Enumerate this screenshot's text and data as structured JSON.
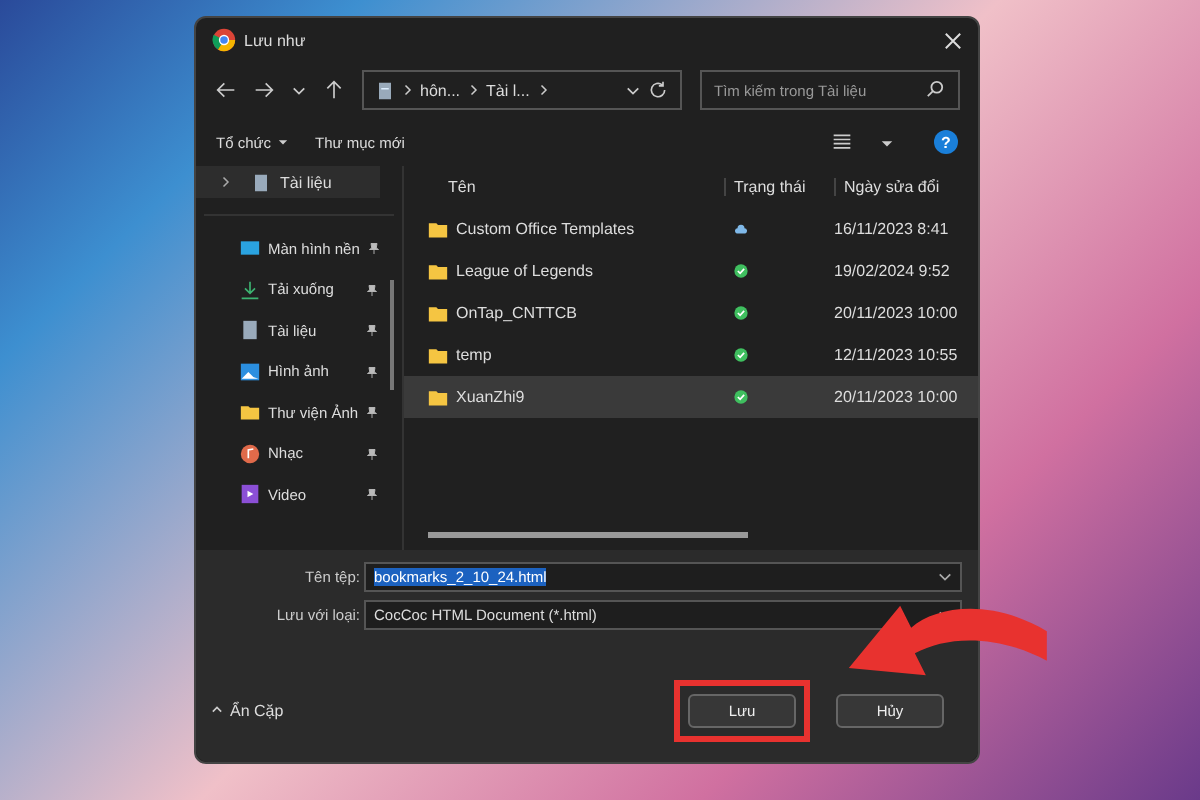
{
  "window": {
    "title": "Lưu như"
  },
  "address": {
    "crumbs": [
      "hôn...",
      "Tài l..."
    ]
  },
  "search": {
    "placeholder": "Tìm kiếm trong Tài liệu"
  },
  "toolbar": {
    "organize": "Tổ chức",
    "new_folder": "Thư mục mới",
    "help": "?"
  },
  "sidebar": {
    "top": {
      "label": "Tài liệu",
      "selected": true
    },
    "items": [
      {
        "label": "Màn hình nền",
        "kind": "desktop",
        "pinned": true
      },
      {
        "label": "Tải xuống",
        "kind": "download",
        "pinned": true
      },
      {
        "label": "Tài liệu",
        "kind": "document",
        "pinned": true
      },
      {
        "label": "Hình ảnh",
        "kind": "picture",
        "pinned": true
      },
      {
        "label": "Thư viện Ảnh",
        "kind": "folder",
        "pinned": true
      },
      {
        "label": "Nhạc",
        "kind": "music",
        "pinned": true
      },
      {
        "label": "Video",
        "kind": "video",
        "pinned": true
      }
    ]
  },
  "table": {
    "columns": [
      "Tên",
      "Trạng thái",
      "Ngày sửa đổi"
    ],
    "rows": [
      {
        "name": "Custom Office Templates",
        "cloud_only": true,
        "date": "16/11/2023 8:41",
        "selected": false
      },
      {
        "name": "League of Legends",
        "cloud_only": false,
        "date": "19/02/2024 9:52",
        "selected": false
      },
      {
        "name": "OnTap_CNTTCB",
        "cloud_only": false,
        "date": "20/11/2023 10:00",
        "selected": false
      },
      {
        "name": "temp",
        "cloud_only": false,
        "date": "12/11/2023 10:55",
        "selected": false
      },
      {
        "name": "XuanZhi9",
        "cloud_only": false,
        "date": "20/11/2023 10:00",
        "selected": true
      }
    ]
  },
  "filename": {
    "label": "Tên tệp:",
    "value": "bookmarks_2_10_24.html"
  },
  "filetype": {
    "label": "Lưu với loại:",
    "value": "CocCoc HTML Document (*.html)"
  },
  "hide_folders": "Ẩn Cặp",
  "buttons": [
    {
      "label": "Lưu",
      "highlighted": true
    },
    {
      "label": "Hủy",
      "highlighted": false
    }
  ]
}
